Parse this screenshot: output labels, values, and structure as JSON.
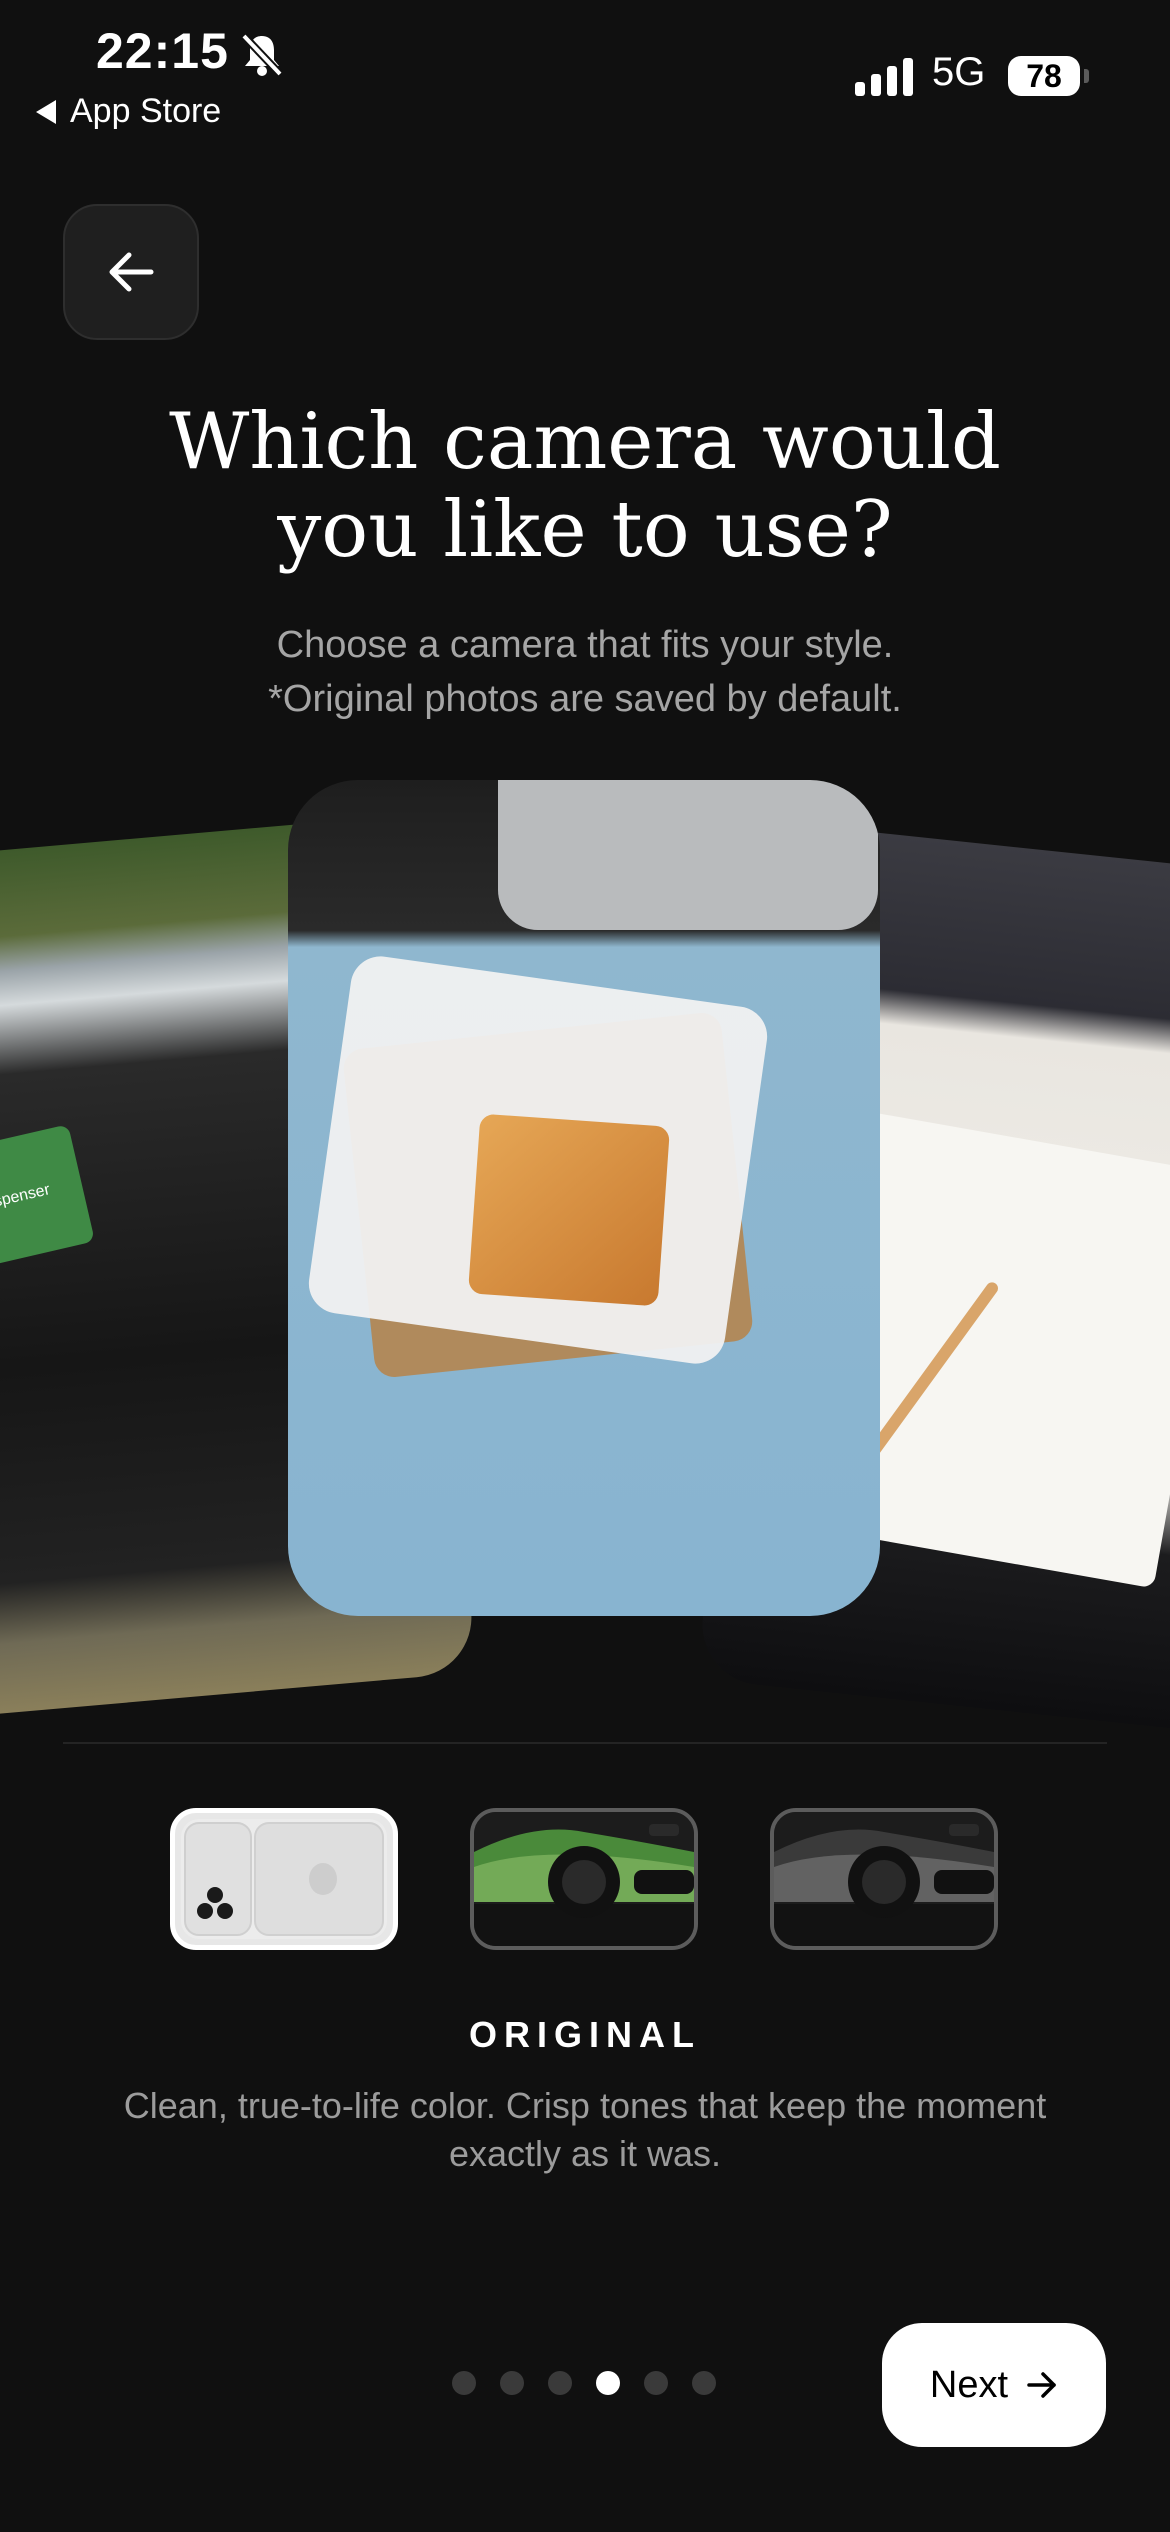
{
  "status_bar": {
    "time": "22:15",
    "back_app": "App Store",
    "network": "5G",
    "battery": "78",
    "icons": [
      "bell-slash-icon",
      "signal-icon"
    ]
  },
  "header": {
    "back_icon": "arrow-left-icon",
    "title": "Which camera would\nyou like to use?",
    "subtitle": "Choose a camera that fits your style.\n*Original photos are saved by default."
  },
  "photos": {
    "left_label": "Bag Dispenser"
  },
  "cameras": {
    "options": [
      "original",
      "green-film",
      "grey-film"
    ],
    "selected_index": 0,
    "selected_name": "ORIGINAL",
    "selected_description": "Clean, true-to-life color. Crisp tones that keep the moment exactly as it was."
  },
  "pagination": {
    "total": 6,
    "current": 4
  },
  "footer": {
    "next_label": "Next",
    "next_icon": "arrow-right-icon"
  },
  "colors": {
    "background": "#101010",
    "primary_text": "#ffffff",
    "secondary_text": "#a5a5a5"
  }
}
